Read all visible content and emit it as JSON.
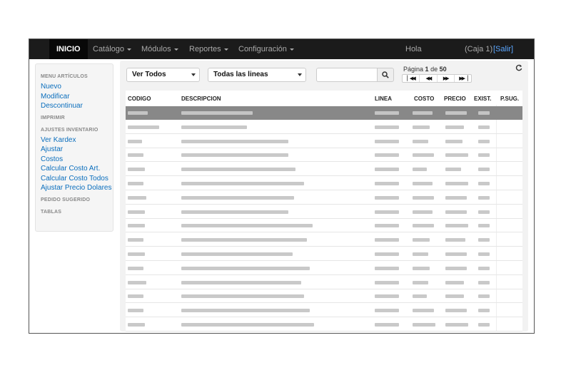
{
  "navbar": {
    "home": "INICIO",
    "menus": [
      "Catálogo",
      "Módulos",
      "Reportes",
      "Configuración"
    ],
    "greeting": "Hola",
    "register": "(Caja 1)",
    "logout": "[Salir]"
  },
  "sidebar": {
    "sections": [
      {
        "title": "MENU ARTÍCULOS",
        "links": [
          "Nuevo",
          "Modificar",
          "Descontinuar"
        ]
      },
      {
        "title": "IMPRIMIR",
        "links": []
      },
      {
        "title": "AJUSTES INVENTARIO",
        "links": [
          "Ver Kardex",
          "Ajustar",
          "Costos",
          "Calcular Costo Art.",
          "Calcular Costo Todos",
          "Ajustar Precio Dolares"
        ]
      },
      {
        "title": "PEDIDO SUGERIDO",
        "links": []
      },
      {
        "title": "TABLAS",
        "links": []
      }
    ]
  },
  "toolbar": {
    "filter_view": "Ver Todos",
    "filter_line": "Todas las lineas",
    "search_value": "",
    "page_label": "Página",
    "page_current": "1",
    "page_of": "de",
    "page_total": "50"
  },
  "table": {
    "headers": [
      "CODIGO",
      "DESCRIPCION",
      "LINEA",
      "COSTO",
      "PRECIO",
      "EXIST.",
      "P.SUG."
    ],
    "rows": 16,
    "selected_row": 0
  }
}
